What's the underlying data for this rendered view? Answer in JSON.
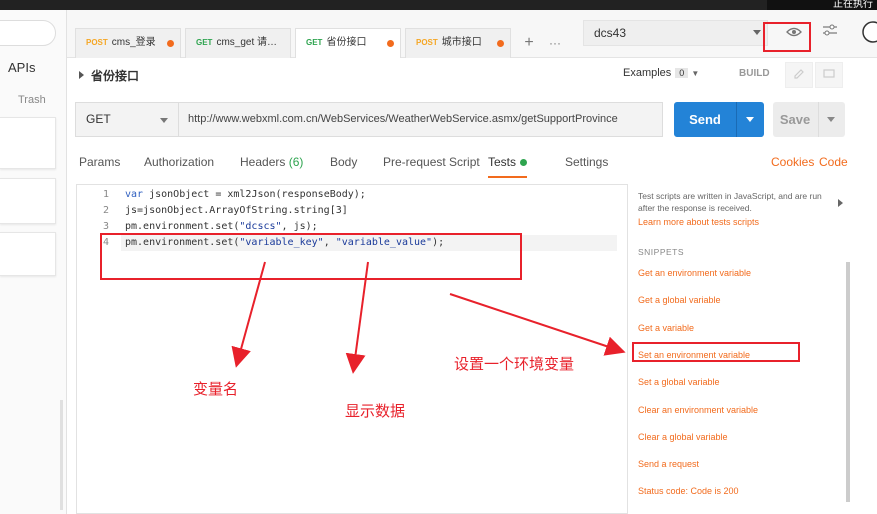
{
  "top_bar": {
    "right_text": "正在执行"
  },
  "sidebar": {
    "apis_label": "APIs",
    "trash_label": "Trash"
  },
  "tabs": [
    {
      "method": "POST",
      "label": "cms_登录",
      "unsaved": true
    },
    {
      "method": "GET",
      "label": "cms_get 请…",
      "unsaved": false
    },
    {
      "method": "GET",
      "label": "省份接口",
      "unsaved": true,
      "active": true
    },
    {
      "method": "POST",
      "label": "城市接口",
      "unsaved": true
    }
  ],
  "tab_actions": {
    "add": "+",
    "more": "···"
  },
  "environment": {
    "selected": "dcs43"
  },
  "request": {
    "name": "省份接口",
    "examples_label": "Examples",
    "examples_count": "0",
    "build_label": "BUILD",
    "method": "GET",
    "url": "http://www.webxml.com.cn/WebServices/WeatherWebService.asmx/getSupportProvince",
    "send_label": "Send",
    "save_label": "Save"
  },
  "subtabs": {
    "params": "Params",
    "authorization": "Authorization",
    "headers": "Headers",
    "headers_count": "(6)",
    "body": "Body",
    "prerequest": "Pre-request Script",
    "tests": "Tests",
    "settings": "Settings",
    "cookies": "Cookies",
    "code": "Code"
  },
  "editor": {
    "lines": [
      {
        "n": "1",
        "parts": [
          {
            "t": "var ",
            "c": "kw"
          },
          {
            "t": "jsonObject = xml2Json(responseBody);",
            "c": ""
          }
        ]
      },
      {
        "n": "2",
        "parts": [
          {
            "t": "js=jsonObject.ArrayOfString.string[3]",
            "c": ""
          }
        ]
      },
      {
        "n": "3",
        "parts": [
          {
            "t": "pm.environment.set(",
            "c": ""
          },
          {
            "t": "\"dcscs\"",
            "c": "str"
          },
          {
            "t": ", js);",
            "c": ""
          }
        ]
      },
      {
        "n": "4",
        "parts": [
          {
            "t": "pm.environment.set(",
            "c": ""
          },
          {
            "t": "\"variable_key\"",
            "c": "str"
          },
          {
            "t": ", ",
            "c": ""
          },
          {
            "t": "\"variable_value\"",
            "c": "str"
          },
          {
            "t": ");",
            "c": ""
          }
        ]
      }
    ]
  },
  "snippets_panel": {
    "description": "Test scripts are written in JavaScript, and are run after the response is received.",
    "learn_more": "Learn more about tests scripts",
    "heading": "SNIPPETS",
    "items": [
      "Get an environment variable",
      "Get a global variable",
      "Get a variable",
      "Set an environment variable",
      "Set a global variable",
      "Clear an environment variable",
      "Clear a global variable",
      "Send a request",
      "Status code: Code is 200"
    ]
  },
  "annotations": {
    "variable_name": "变量名",
    "display_data": "显示数据",
    "set_env_var": "设置一个环境变量"
  },
  "colors": {
    "accent": "#f26b1d",
    "send": "#2383d7",
    "annotation": "#e8212b",
    "tests_dot": "#2ea44f"
  }
}
